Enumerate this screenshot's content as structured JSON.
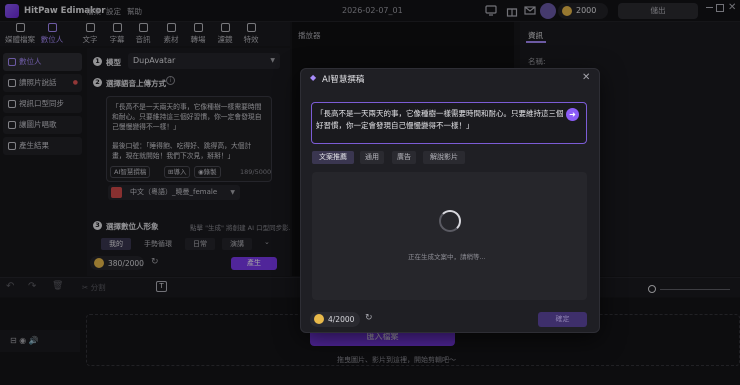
{
  "app": {
    "name": "HitPaw Edimakor",
    "menus": [
      "檔案",
      "設定",
      "幫助"
    ],
    "document_title": "2026-02-07_01",
    "credits": "2000",
    "logout_label": "儲出"
  },
  "toolbar": {
    "items": [
      "媒體檔案",
      "數位人",
      "文字",
      "字幕",
      "音訊",
      "素材",
      "轉場",
      "濾鏡",
      "特效"
    ]
  },
  "sidebar": {
    "items": [
      "數位人",
      "讀照片說話",
      "視訊口型同步",
      "讓圖片唱歌",
      "產生結果"
    ]
  },
  "settings": {
    "step1_label": "模型",
    "model_value": "DupAvatar",
    "step2_label": "選擇語音上傳方式",
    "script_lines": [
      "「長高不是一天兩天的事，它像種樹一樣需要時間",
      "和耐心。只要維持這三個好習慣，你一定會發現自",
      "己慢慢變得不一樣！」",
      "",
      "最後口號：「睡得飽、吃得好、跳得高，大個計",
      "畫，現在就開始！我們下次見，掰掰！」"
    ],
    "ai_write_label": "AI智慧撰稿",
    "import_label": "導入",
    "record_label": "錄製",
    "char_count": "189/5000",
    "voice_label": "中文（粵語）_曉曼_female",
    "step3_label": "選擇數位人形象",
    "step3_hint": "點擊 \"生成\" 將創建 AI 口型同步影...",
    "avatar_tabs": [
      "我的",
      "手勢循環",
      "日常",
      "演講"
    ],
    "credit_usage": "380/2000",
    "generate_label": "產生"
  },
  "player": {
    "title": "播放器"
  },
  "right_panel": {
    "tab": "資訊",
    "name_label": "名稱:"
  },
  "timeline": {
    "split_label": "分割",
    "import_label": "匯入檔案",
    "drop_hint": "拖曳圖片、影片到這裡，開始剪輯吧～"
  },
  "modal": {
    "title": "AI智慧撰稿",
    "input_lines": [
      "「長高不是一天兩天的事，它像種樹一樣需要時間和耐心。只要維持這三個",
      "好習慣，你一定會發現自己慢慢變得不一樣！」"
    ],
    "tabs": [
      "文案推薦",
      "通用",
      "廣告",
      "解說影片"
    ],
    "generating_text": "正在生成文案中，請稍等...",
    "credit_usage": "4/2000",
    "confirm_label": "確定"
  },
  "colors": {
    "accent": "#7c3aed",
    "accent_light": "#a78bfa",
    "background": "#17171b",
    "coin": "#e8b94a"
  }
}
